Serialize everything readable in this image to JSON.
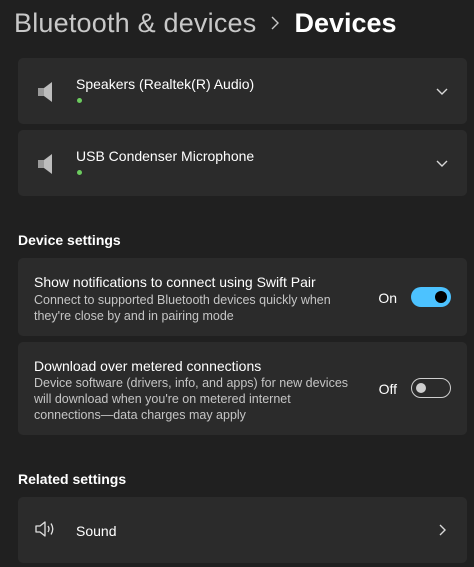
{
  "breadcrumb": {
    "parent": "Bluetooth & devices",
    "separator": ">",
    "current": "Devices"
  },
  "devices": [
    {
      "name": "Speakers (Realtek(R) Audio)",
      "icon": "speaker-icon",
      "status_color": "#6ccb5f"
    },
    {
      "name": "USB Condenser Microphone",
      "icon": "speaker-icon",
      "status_color": "#6ccb5f"
    }
  ],
  "device_settings": {
    "heading": "Device settings",
    "swift_pair": {
      "title": "Show notifications to connect using Swift Pair",
      "description": "Connect to supported Bluetooth devices quickly when they're close by and in pairing mode",
      "state_label": "On",
      "on": true
    },
    "metered": {
      "title": "Download over metered connections",
      "description": "Device software (drivers, info, and apps) for new devices will download when you're on metered internet connections—data charges may apply",
      "state_label": "Off",
      "on": false
    }
  },
  "related_settings": {
    "heading": "Related settings",
    "sound": {
      "label": "Sound",
      "icon": "sound-icon"
    }
  },
  "colors": {
    "background": "#202020",
    "card": "#2b2b2b",
    "accent": "#4cc2ff",
    "status_connected": "#6ccb5f"
  }
}
